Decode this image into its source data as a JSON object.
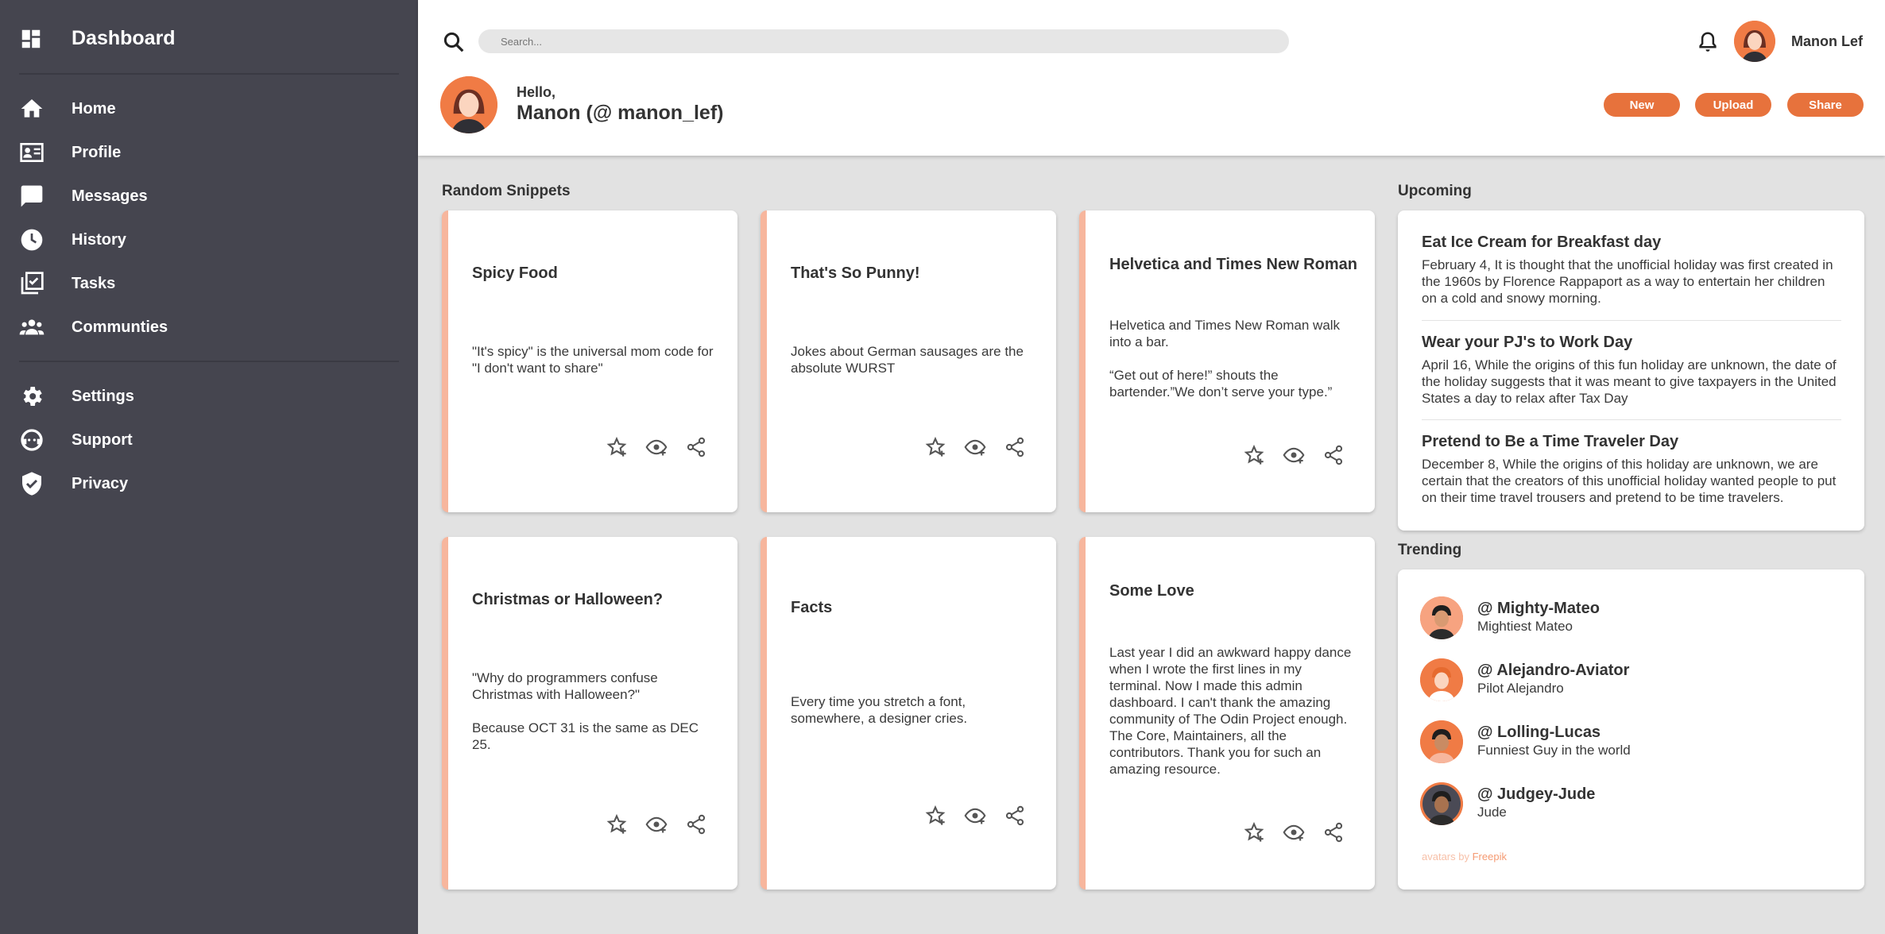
{
  "sidebar": {
    "title": "Dashboard",
    "items": [
      {
        "label": "Home",
        "icon": "home-icon"
      },
      {
        "label": "Profile",
        "icon": "profile-card-icon"
      },
      {
        "label": "Messages",
        "icon": "chat-icon"
      },
      {
        "label": "History",
        "icon": "clock-icon"
      },
      {
        "label": "Tasks",
        "icon": "tasks-icon"
      },
      {
        "label": "Communties",
        "icon": "people-icon"
      },
      {
        "label": "Settings",
        "icon": "gear-icon"
      },
      {
        "label": "Support",
        "icon": "support-icon"
      },
      {
        "label": "Privacy",
        "icon": "shield-icon"
      }
    ]
  },
  "header": {
    "search_placeholder": "Search...",
    "user_name": "Manon Lef",
    "greeting": "Hello,",
    "handle": "Manon (@ manon_lef)",
    "buttons": {
      "new": "New",
      "upload": "Upload",
      "share": "Share"
    }
  },
  "snippets": {
    "title": "Random Snippets",
    "cards": [
      {
        "title": "Spicy Food",
        "body": [
          "\"It's spicy\" is the universal mom code for \"I don't want to share\""
        ]
      },
      {
        "title": "That's So Punny!",
        "body": [
          "Jokes about German sausages are the absolute WURST"
        ]
      },
      {
        "title": "Helvetica and Times New Roman",
        "body": [
          "Helvetica and Times New Roman walk into a bar.",
          "“Get out of here!” shouts the bartender.”We don’t serve your type.”"
        ]
      },
      {
        "title": "Christmas or Halloween?",
        "body": [
          "\"Why do programmers confuse Christmas with Halloween?\"",
          "Because OCT 31 is the same as DEC 25."
        ]
      },
      {
        "title": "Facts",
        "body": [
          "Every time you stretch a font, somewhere, a designer cries."
        ]
      },
      {
        "title": "Some Love",
        "body": [
          "Last year I did an awkward happy dance when I wrote the first lines in my terminal. Now I made this admin dashboard. I can't thank the amazing community of The Odin Project enough. The Core, Maintainers, all the contributors. Thank you for such an amazing resource."
        ]
      }
    ]
  },
  "upcoming": {
    "title": "Upcoming",
    "items": [
      {
        "title": "Eat Ice Cream for Breakfast day",
        "desc": "February 4, It is thought that the unofficial holiday was first created in the 1960s by Florence Rappaport as a way to entertain her children on a cold and snowy morning."
      },
      {
        "title": "Wear your PJ's to Work Day",
        "desc": "April 16, While the origins of this fun holiday are unknown, the date of the holiday suggests that it was meant to give taxpayers in the United States a day to relax after Tax Day"
      },
      {
        "title": "Pretend to Be a Time Traveler Day",
        "desc": "December 8, While the origins of this holiday are unknown, we are certain that the creators of this unofficial holiday wanted people to put on their time travel trousers and pretend to be time travelers."
      }
    ]
  },
  "trending": {
    "title": "Trending",
    "items": [
      {
        "name": "@ Mighty-Mateo",
        "sub": "Mightiest Mateo"
      },
      {
        "name": "@ Alejandro-Aviator",
        "sub": "Pilot Alejandro"
      },
      {
        "name": "@ Lolling-Lucas",
        "sub": "Funniest Guy in the world"
      },
      {
        "name": "@ Judgey-Jude",
        "sub": "Jude"
      }
    ],
    "credit_prefix": "avatars by",
    "credit_link": "Freepik"
  },
  "colors": {
    "sidebar_bg": "#45454f",
    "accent": "#e7723c",
    "card_border": "#f7b69d",
    "background": "#e2e2e2"
  }
}
